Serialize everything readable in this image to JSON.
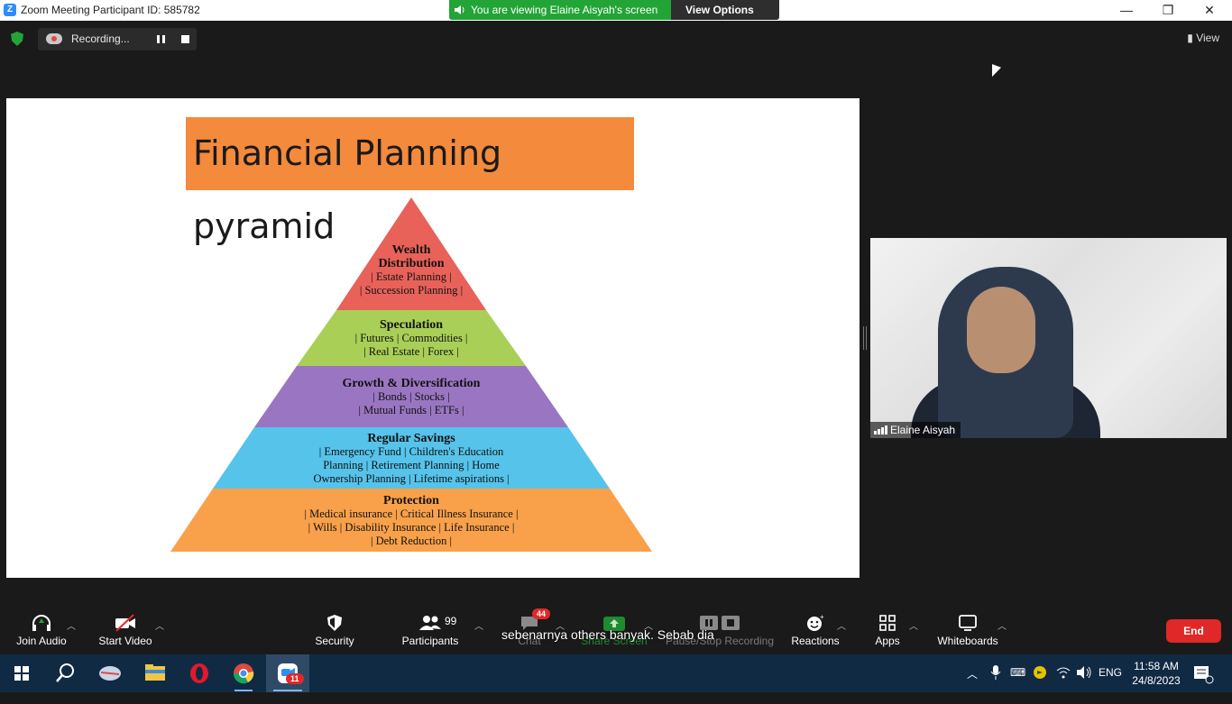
{
  "titlebar": {
    "title": "Zoom Meeting Participant ID: 585782",
    "minimize": "—",
    "restore": "❐",
    "close": "✕"
  },
  "banner": {
    "viewing_text": "You are viewing Elaine Aisyah's screen",
    "view_options": "View Options"
  },
  "recording": {
    "status": "Recording..."
  },
  "view_button": "View",
  "slide": {
    "title": "Financial Planning pyramid",
    "layers": [
      {
        "title": "Wealth",
        "title2": "Distribution",
        "lines": [
          "| Estate Planning |",
          "| Succession Planning |"
        ],
        "color": "#e8625a"
      },
      {
        "title": "Speculation",
        "lines": [
          "| Futures | Commodities |",
          "| Real Estate | Forex |"
        ],
        "color": "#a9cf57"
      },
      {
        "title": "Growth & Diversification",
        "lines": [
          "| Bonds | Stocks |",
          "| Mutual Funds | ETFs |"
        ],
        "color": "#9a76c2"
      },
      {
        "title": "Regular Savings",
        "lines": [
          "| Emergency Fund | Children's Education",
          "Planning | Retirement Planning | Home",
          "Ownership Planning | Lifetime aspirations |"
        ],
        "color": "#56c3ea"
      },
      {
        "title": "Protection",
        "lines": [
          "| Medical insurance | Critical Illness Insurance |",
          "| Wills | Disability Insurance | Life Insurance |",
          "| Debt Reduction |"
        ],
        "color": "#f8a14a"
      }
    ]
  },
  "video": {
    "name": "Elaine Aisyah"
  },
  "toolbar": {
    "join_audio": "Join Audio",
    "start_video": "Start Video",
    "security": "Security",
    "participants": "Participants",
    "participants_count": "99",
    "chat": "Chat",
    "chat_badge": "44",
    "share_screen": "Share Screen",
    "pause_stop_recording": "Pause/Stop Recording",
    "reactions": "Reactions",
    "apps": "Apps",
    "whiteboards": "Whiteboards",
    "end": "End"
  },
  "caption": "sebenarnya others banyak. Sebab dia",
  "taskbar": {
    "zoom_badge": "11",
    "language": "ENG",
    "time": "11:58 AM",
    "date": "24/8/2023"
  }
}
